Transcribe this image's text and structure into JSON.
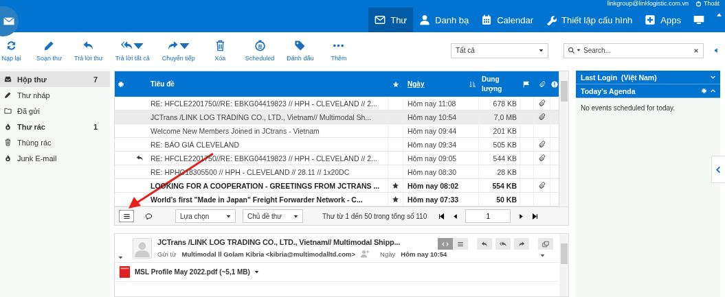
{
  "header": {
    "user_email": "linkgroup@linklogistic.com.vn",
    "logout": "Thoát",
    "nav": [
      {
        "label": "Thư",
        "kind": "mail",
        "selected": true
      },
      {
        "label": "Danh bạ",
        "kind": "contacts",
        "selected": false
      },
      {
        "label": "Calendar",
        "kind": "calendar",
        "selected": false
      },
      {
        "label": "Thiết lập cấu hình",
        "kind": "settings",
        "selected": false
      },
      {
        "label": "Apps",
        "kind": "apps",
        "selected": false
      }
    ]
  },
  "toolbar": {
    "buttons": [
      {
        "label": "Nạp lại",
        "kind": "refresh",
        "dropdown": false
      },
      {
        "label": "Soạn thư",
        "kind": "compose",
        "dropdown": false
      },
      {
        "label": "Trả lời thư",
        "kind": "reply",
        "dropdown": false
      },
      {
        "label": "Trả lời tất cả",
        "kind": "replyall",
        "dropdown": true
      },
      {
        "label": "Chuyển tiếp",
        "kind": "forward",
        "dropdown": true
      },
      {
        "label": "Xóa",
        "kind": "delete",
        "dropdown": false
      },
      {
        "label": "Scheduled",
        "kind": "scheduled",
        "dropdown": false
      },
      {
        "label": "Đánh dấu",
        "kind": "mark",
        "dropdown": false
      },
      {
        "label": "Thêm",
        "kind": "more",
        "dropdown": false
      }
    ],
    "filter": {
      "value": "Tất cả"
    },
    "search": {
      "placeholder": "Search..."
    }
  },
  "folders": [
    {
      "label": "Hộp thư",
      "kind": "inbox",
      "count": "7",
      "unread": true,
      "selected": true
    },
    {
      "label": "Thư nháp",
      "kind": "drafts",
      "unread": false,
      "selected": false
    },
    {
      "label": "Đã gửi",
      "kind": "sent",
      "unread": false,
      "selected": false
    },
    {
      "label": "Thư rác",
      "kind": "junk",
      "count": "1",
      "unread": true,
      "selected": false
    },
    {
      "label": "Thùng rác",
      "kind": "trash",
      "unread": false,
      "selected": false
    },
    {
      "label": "Junk E-mail",
      "kind": "junk",
      "unread": false,
      "selected": false
    }
  ],
  "table": {
    "columns": {
      "subject": "Tiêu đề",
      "date": "Ngày",
      "size": "Dung lượng"
    },
    "rows": [
      {
        "subject": "RE: HFCLE2201750//RE: EBKG04419823 // HPH - CLEVELAND // 2...",
        "date": "Hôm nay 11:08",
        "size": "678 KB",
        "attachment": true,
        "starred": false,
        "unread": false,
        "replied": false,
        "selected": false
      },
      {
        "subject": "JCTrans /LINK LOG TRADING CO., LTD., Vietnam// Multimodal Sh...",
        "date": "Hôm nay 10:54",
        "size": "7,0 MB",
        "attachment": true,
        "starred": false,
        "unread": false,
        "replied": false,
        "selected": true
      },
      {
        "subject": "Welcome New Members Joined in JCtrans - Vietnam",
        "date": "Hôm nay 09:44",
        "size": "201 KB",
        "attachment": false,
        "starred": false,
        "unread": false,
        "replied": false,
        "selected": false
      },
      {
        "subject": "RE: BÁO GIÁ CLEVELAND",
        "date": "Hôm nay 09:34",
        "size": "505 KB",
        "attachment": true,
        "starred": false,
        "unread": false,
        "replied": false,
        "selected": false
      },
      {
        "subject": "RE: HFCLE2201750//RE: EBKG04419823 // HPH - CLEVELAND // 2...",
        "date": "Hôm nay 09:05",
        "size": "544 KB",
        "attachment": true,
        "starred": false,
        "unread": false,
        "replied": true,
        "selected": false
      },
      {
        "subject": "RE: HPHC18305500 // HPH - CLEVELAND // 28.11 // 1x20DC",
        "date": "Hôm nay 08:30",
        "size": "28 KB",
        "attachment": false,
        "starred": false,
        "unread": false,
        "replied": false,
        "selected": false
      },
      {
        "subject": "LOOKING FOR A COOPERATION - GREETINGS FROM JCTRANS ...",
        "date": "Hôm nay 08:02",
        "size": "554 KB",
        "attachment": true,
        "starred": true,
        "unread": true,
        "replied": false,
        "selected": false
      },
      {
        "subject": "World’s first \"Made in Japan\" Freight Forwarder Network - C...",
        "date": "Hôm nay 07:33",
        "size": "50 KB",
        "attachment": false,
        "starred": true,
        "unread": true,
        "replied": false,
        "selected": false
      }
    ]
  },
  "pager": {
    "select_filter": "Lựa chọn",
    "thread_filter": "Chủ đề thư",
    "summary": "Thư từ 1 đến 50 trong tổng số 110",
    "page": "1"
  },
  "preview": {
    "subject": "JCTrans /LINK LOG TRADING CO., LTD., Vietnam// Multimodal Shipp...",
    "from_label": "Gửi từ",
    "from": "Multimodal ll Golam Kibria <kibria@multimodalltd.com>",
    "date_label": "Ngày",
    "date": "Hôm nay 10:54",
    "attachment": "MSL Profile May 2022.pdf (~5,1 MB)"
  },
  "side": {
    "panels": [
      {
        "title": "Last Login  (Việt Nam)",
        "expanded": false,
        "settings": false
      },
      {
        "title": "Today's Agenda",
        "expanded": true,
        "settings": true
      }
    ],
    "empty_text": "No events scheduled for today."
  }
}
